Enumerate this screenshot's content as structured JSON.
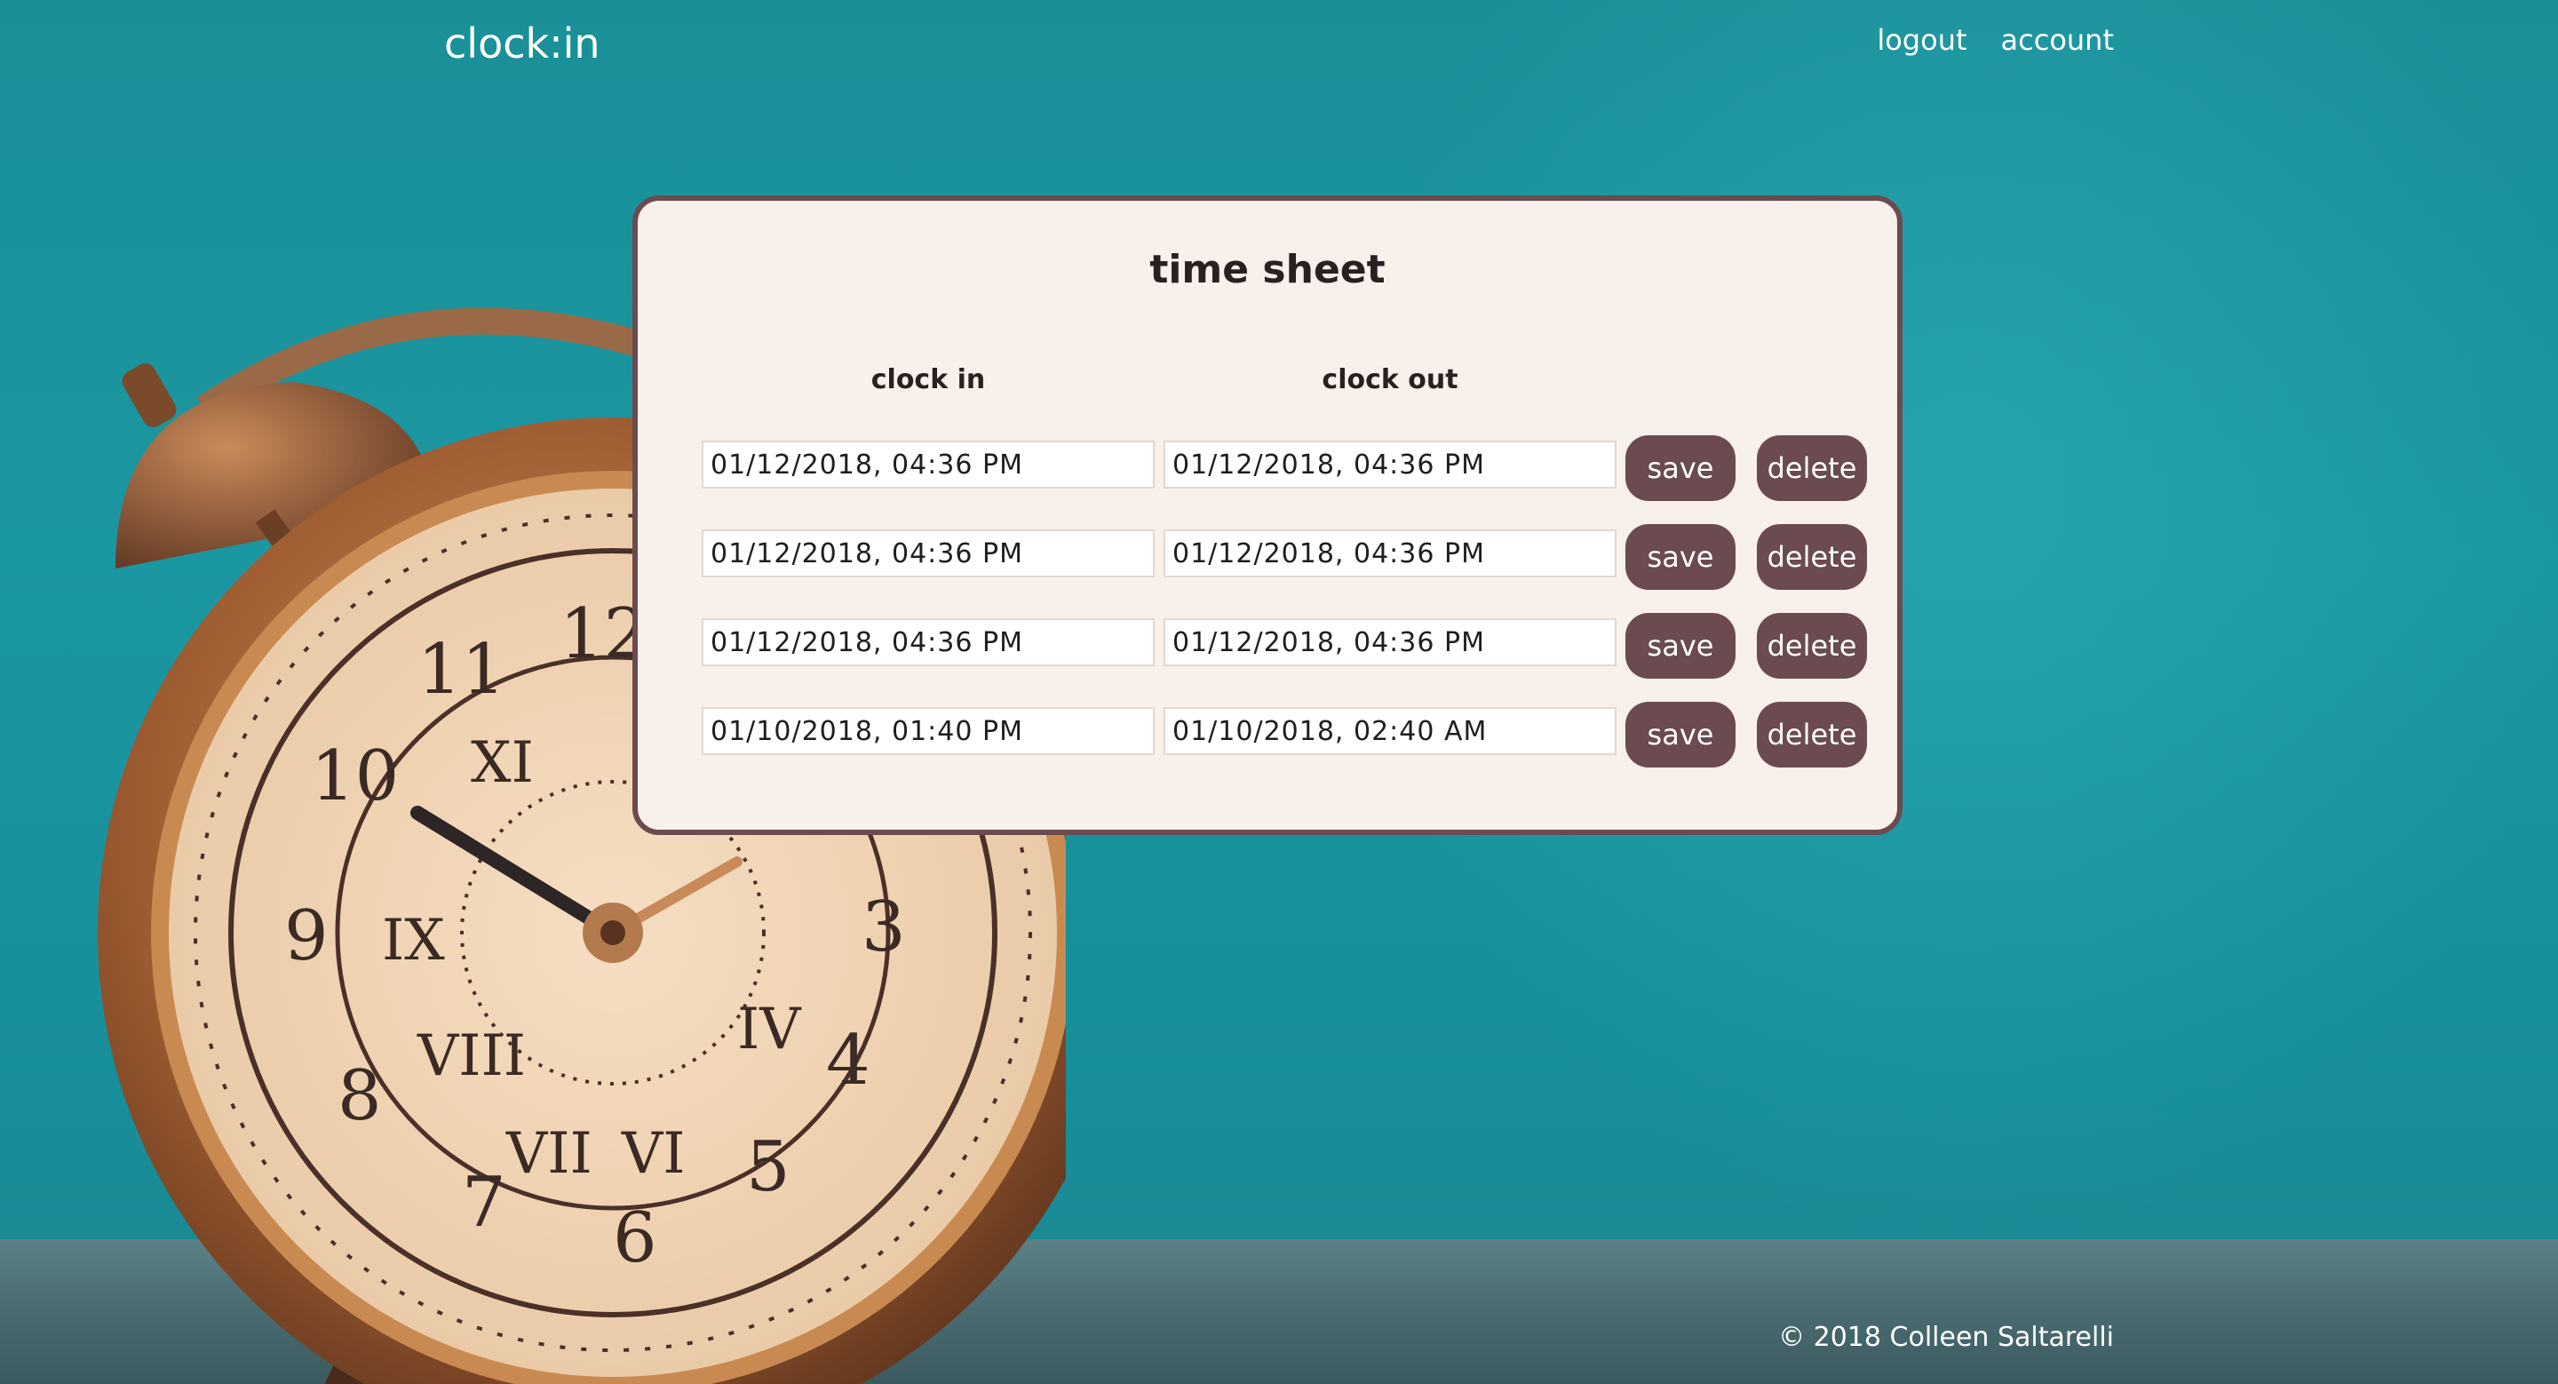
{
  "header": {
    "brand": "clock:in",
    "nav": [
      {
        "label": "logout"
      },
      {
        "label": "account"
      }
    ]
  },
  "timesheet": {
    "title": "time sheet",
    "columns": {
      "clock_in": "clock in",
      "clock_out": "clock out"
    },
    "rows": [
      {
        "clock_in": "01/12/2018, 04:36 PM",
        "clock_out": "01/12/2018, 04:36 PM",
        "save_label": "save",
        "delete_label": "delete"
      },
      {
        "clock_in": "01/12/2018, 04:36 PM",
        "clock_out": "01/12/2018, 04:36 PM",
        "save_label": "save",
        "delete_label": "delete"
      },
      {
        "clock_in": "01/12/2018, 04:36 PM",
        "clock_out": "01/12/2018, 04:36 PM",
        "save_label": "save",
        "delete_label": "delete"
      },
      {
        "clock_in": "01/10/2018, 01:40 PM",
        "clock_out": "01/10/2018, 02:40 AM",
        "save_label": "save",
        "delete_label": "delete"
      }
    ]
  },
  "footer": {
    "text": "© 2018 Colleen Saltarelli"
  },
  "colors": {
    "background": "#1b97a1",
    "card": "#f8f0ea",
    "accent": "#6b4b4f"
  },
  "background_image": {
    "subject": "alarm-clock"
  }
}
